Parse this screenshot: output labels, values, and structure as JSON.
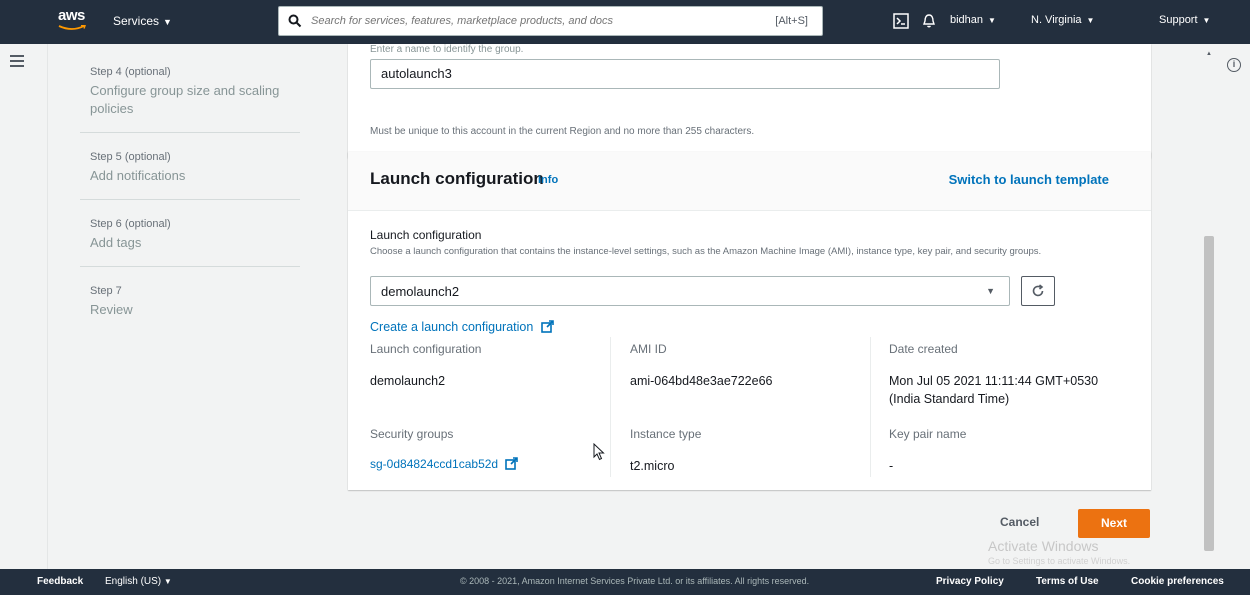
{
  "topnav": {
    "logo_text": "aws",
    "services_label": "Services",
    "search_placeholder": "Search for services, features, marketplace products, and docs",
    "search_shortcut": "[Alt+S]",
    "user": "bidhan",
    "region": "N. Virginia",
    "support": "Support",
    "colors": {
      "bg": "#232f3e",
      "accent": "#ff9900"
    }
  },
  "steps": [
    {
      "num": "Step 4 (optional)",
      "label": "Configure group size and scaling policies"
    },
    {
      "num": "Step 5 (optional)",
      "label": "Add notifications"
    },
    {
      "num": "Step 6 (optional)",
      "label": "Add tags"
    },
    {
      "num": "Step 7",
      "label": "Review"
    }
  ],
  "group_name": {
    "hint": "Enter a name to identify the group.",
    "value": "autolaunch3",
    "help": "Must be unique to this account in the current Region and no more than 255 characters."
  },
  "launch_config": {
    "title": "Launch configuration",
    "info_link": "Info",
    "switch_link": "Switch to launch template",
    "field_label": "Launch configuration",
    "field_desc": "Choose a launch configuration that contains the instance-level settings, such as the Amazon Machine Image (AMI), instance type, key pair, and security groups.",
    "selected": "demolaunch2",
    "create_link": "Create a launch configuration",
    "details": {
      "lc_label": "Launch configuration",
      "lc_value": "demolaunch2",
      "ami_label": "AMI ID",
      "ami_value": "ami-064bd48e3ae722e66",
      "date_label": "Date created",
      "date_value": "Mon Jul 05 2021 11:11:44 GMT+0530 (India Standard Time)",
      "sg_label": "Security groups",
      "sg_value": "sg-0d84824ccd1cab52d",
      "type_label": "Instance type",
      "type_value": "t2.micro",
      "key_label": "Key pair name",
      "key_value": "-"
    }
  },
  "actions": {
    "cancel": "Cancel",
    "next": "Next",
    "next_color": "#ec7211"
  },
  "watermark": {
    "line1": "Activate Windows",
    "line2": "Go to Settings to activate Windows."
  },
  "footer": {
    "feedback": "Feedback",
    "language": "English (US)",
    "copyright": "© 2008 - 2021, Amazon Internet Services Private Ltd. or its affiliates. All rights reserved.",
    "privacy": "Privacy Policy",
    "terms": "Terms of Use",
    "cookies": "Cookie preferences"
  }
}
